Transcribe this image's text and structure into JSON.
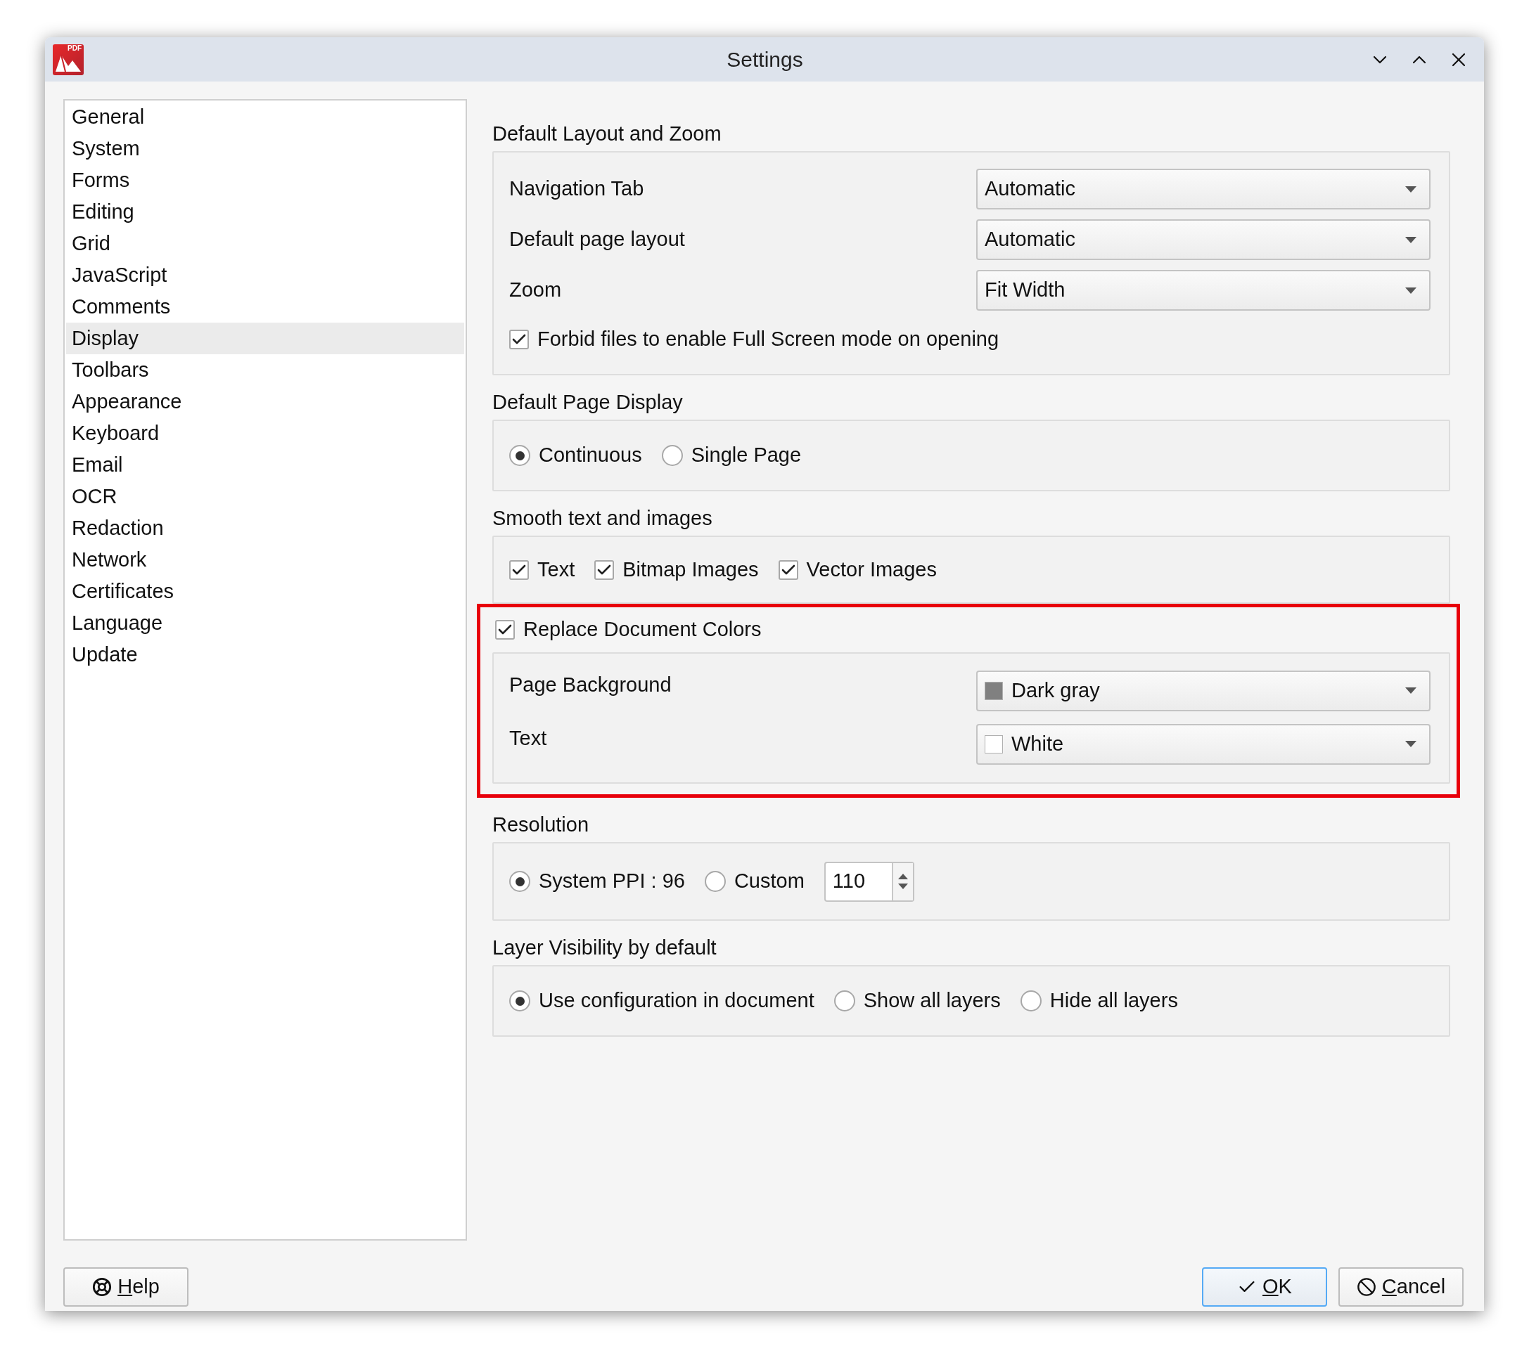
{
  "window": {
    "title": "Settings",
    "logo_text": "PDF"
  },
  "sidebar": {
    "items": [
      {
        "label": "General",
        "selected": false
      },
      {
        "label": "System",
        "selected": false
      },
      {
        "label": "Forms",
        "selected": false
      },
      {
        "label": "Editing",
        "selected": false
      },
      {
        "label": "Grid",
        "selected": false
      },
      {
        "label": "JavaScript",
        "selected": false
      },
      {
        "label": "Comments",
        "selected": false
      },
      {
        "label": "Display",
        "selected": true
      },
      {
        "label": "Toolbars",
        "selected": false
      },
      {
        "label": "Appearance",
        "selected": false
      },
      {
        "label": "Keyboard",
        "selected": false
      },
      {
        "label": "Email",
        "selected": false
      },
      {
        "label": "OCR",
        "selected": false
      },
      {
        "label": "Redaction",
        "selected": false
      },
      {
        "label": "Network",
        "selected": false
      },
      {
        "label": "Certificates",
        "selected": false
      },
      {
        "label": "Language",
        "selected": false
      },
      {
        "label": "Update",
        "selected": false
      }
    ]
  },
  "sections": [
    {
      "kind": "form",
      "title": "Default Layout and Zoom",
      "rows": [
        {
          "label": "Navigation Tab",
          "value": "Automatic"
        },
        {
          "label": "Default page layout",
          "value": "Automatic"
        },
        {
          "label": "Zoom",
          "value": "Fit Width"
        }
      ],
      "checkbox": {
        "label": "Forbid files to enable Full Screen mode on opening",
        "checked": true
      }
    },
    {
      "kind": "radios",
      "title": "Default Page Display",
      "options": [
        {
          "label": "Continuous",
          "selected": true
        },
        {
          "label": "Single Page",
          "selected": false
        }
      ]
    },
    {
      "kind": "checks",
      "title": "Smooth text and images",
      "options": [
        {
          "label": "Text",
          "checked": true
        },
        {
          "label": "Bitmap Images",
          "checked": true
        },
        {
          "label": "Vector Images",
          "checked": true
        }
      ]
    },
    {
      "kind": "colors",
      "highlighted": true,
      "checkbox": {
        "label": "Replace Document Colors",
        "checked": true
      },
      "rows": [
        {
          "label": "Page Background",
          "value": "Dark gray",
          "color": "#808080"
        },
        {
          "label": "Text",
          "value": "White",
          "color": "#ffffff"
        }
      ]
    },
    {
      "kind": "radios",
      "title": "Resolution",
      "options": [
        {
          "label": "System PPI : 96",
          "selected": true
        },
        {
          "label": "Custom",
          "selected": false
        }
      ],
      "spin": {
        "value": "110"
      }
    },
    {
      "kind": "radios",
      "title": "Layer Visibility by default",
      "options": [
        {
          "label": "Use configuration in document",
          "selected": true
        },
        {
          "label": "Show all layers",
          "selected": false
        },
        {
          "label": "Hide all layers",
          "selected": false
        }
      ]
    }
  ],
  "buttons": [
    {
      "kind": "help",
      "label": "Help",
      "default": false
    },
    {
      "kind": "ok",
      "label": "OK",
      "default": true
    },
    {
      "kind": "cancel",
      "label": "Cancel",
      "default": false
    }
  ]
}
